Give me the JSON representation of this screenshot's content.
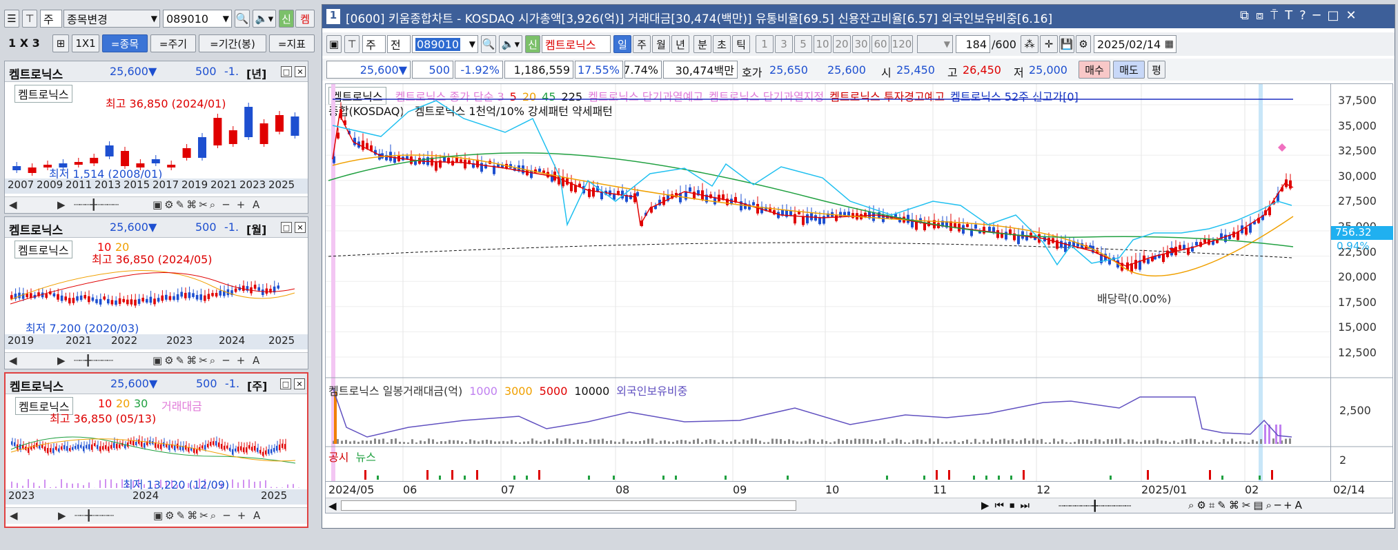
{
  "left": {
    "toolbar": {
      "mode": "주",
      "change_label": "종목변경",
      "code": "089010",
      "tag": "신",
      "name_tag": "켐"
    },
    "row2": {
      "layout": "1 X 3",
      "btn_1x1": "1X1",
      "btn_item": "=종목",
      "btn_period": "=주기",
      "btn_range": "=기간(봉)",
      "btn_indicator": "=지표"
    },
    "panels": [
      {
        "title": "켐트로닉스",
        "price": "25,600▼",
        "change": "500",
        "rate": "-1.",
        "period": "[년]",
        "tag": "켐트로닉스",
        "legend": [],
        "high": "최고 36,850 (2024/01)",
        "low": "최저 1,514 (2008/01)",
        "years": [
          "2007",
          "2009",
          "2011",
          "2013",
          "2015",
          "2017",
          "2019",
          "2021",
          "2023",
          "2025"
        ]
      },
      {
        "title": "켐트로닉스",
        "price": "25,600▼",
        "change": "500",
        "rate": "-1.",
        "period": "[월]",
        "tag": "켐트로닉스",
        "legend": [
          "10",
          "20"
        ],
        "high": "최고 36,850 (2024/05)",
        "low": "최저 7,200 (2020/03)",
        "years": [
          "2019",
          "2021",
          "2022",
          "2023",
          "2024",
          "2025"
        ]
      },
      {
        "title": "켐트로닉스",
        "price": "25,600▼",
        "change": "500",
        "rate": "-1.",
        "period": "[주]",
        "tag": "켐트로닉스",
        "legend": [
          "10",
          "20",
          "30",
          "거래대금"
        ],
        "high": "최고 36,850 (05/13)",
        "low": "최저 13,220 (12/09)",
        "years": [
          "2023",
          "2024",
          "2025"
        ]
      }
    ]
  },
  "main": {
    "title": "[0600] 키움종합차트 - KOSDAQ 시가총액[3,926(억)] 거래대금[30,474(백만)] 유통비율[69.5] 신용잔고비율[6.57] 외국인보유비중[6.16]",
    "window_num": "1",
    "toolbar": {
      "period": "주",
      "prev": "전",
      "code": "089010",
      "tag": "신",
      "stock": "켐트로닉스",
      "periods": [
        "일",
        "주",
        "월",
        "년",
        "분",
        "초",
        "틱"
      ],
      "nums": [
        "1",
        "3",
        "5",
        "10",
        "20",
        "30",
        "60",
        "120"
      ],
      "count": "184",
      "total": "/600",
      "date": "2025/02/14"
    },
    "quote": {
      "price": "25,600▼",
      "change": "500",
      "rate": "-1.92%",
      "volume": "1,186,559",
      "turnover": "17.55%",
      "ratio": "7.74%",
      "amount": "30,474백만",
      "bid_label": "호가",
      "bid1": "25,650",
      "bid2": "25,600",
      "open_label": "시",
      "open": "25,450",
      "high_label": "고",
      "high": "26,450",
      "low_label": "저",
      "low": "25,000",
      "buy": "매수",
      "sell": "매도",
      "avg": "평"
    },
    "legend1": [
      {
        "text": "켐트로닉스 종가 단순 3",
        "color": "#e07ad8"
      },
      {
        "text": "5",
        "color": "#e00000"
      },
      {
        "text": "20",
        "color": "#f0a000"
      },
      {
        "text": "45",
        "color": "#20a040"
      },
      {
        "text": "225",
        "color": "#111111"
      },
      {
        "text": "켐트로닉스 단기과열예고",
        "color": "#e07ad8"
      },
      {
        "text": "켐트로닉스 단기과열지정",
        "color": "#e07ad8"
      },
      {
        "text": "켐트로닉스 투자경고예고",
        "color": "#d00000"
      },
      {
        "text": "켐트로닉스 52주 신고가[0]",
        "color": "#1030c0"
      }
    ],
    "legend2": [
      "종합(KOSDAQ)",
      "켐트로닉스 1천억/10% 강세패턴  약세패턴"
    ],
    "legend_vol": [
      {
        "text": "켐트로닉스 일봉거래대금(억)",
        "color": "#333333"
      },
      {
        "text": "1000",
        "color": "#c080f0"
      },
      {
        "text": "3000",
        "color": "#f0a000"
      },
      {
        "text": "5000",
        "color": "#e00000"
      },
      {
        "text": "10000",
        "color": "#111111"
      },
      {
        "text": "외국인보유비중",
        "color": "#6050c0"
      }
    ],
    "legend_news": [
      {
        "text": "공시",
        "color": "#d00000"
      },
      {
        "text": "뉴스",
        "color": "#20a040"
      }
    ],
    "dividend_label": "배당락(0.00%)",
    "yaxis": [
      "37,500",
      "35,000",
      "32,500",
      "30,000",
      "27,500",
      "25,000",
      "22,500",
      "20,000",
      "17,500",
      "15,000",
      "12,500"
    ],
    "index_value": "756.32",
    "index_rate": "0.94%",
    "vol_axis": "2,500",
    "news_axis": "2",
    "xaxis": [
      "2024/05",
      "06",
      "07",
      "08",
      "09",
      "10",
      "11",
      "12",
      "2025/01",
      "02",
      "02/14"
    ]
  }
}
